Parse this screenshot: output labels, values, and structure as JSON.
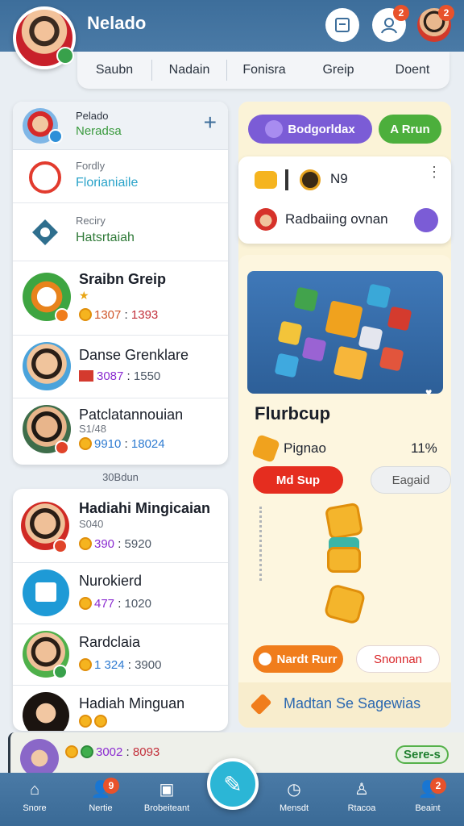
{
  "header": {
    "title": "Nelado",
    "notif_count_1": "2",
    "notif_count_2": "2"
  },
  "tabs": [
    "Saubn",
    "Nadain",
    "Fonisra",
    "Greip",
    "Doent"
  ],
  "left_panel": {
    "head": {
      "title": "Pelado",
      "subtitle": "Neradsa",
      "add_label": "+"
    },
    "rows": [
      {
        "small": "Fordly",
        "big": "Florianiaile"
      },
      {
        "small": "Reciry",
        "big": "Hatsrtaiah"
      },
      {
        "big": "Sraibn Greip",
        "stat1": "1307",
        "stat2": "1393"
      },
      {
        "big": "Danse Grenklare",
        "stat1": "3087",
        "stat2": "1550"
      },
      {
        "big": "Patclatannouian",
        "small": "S1/48",
        "stat1": "9910",
        "stat2": "18024"
      }
    ]
  },
  "section_label": "30Bdun",
  "left_panel2": {
    "rows": [
      {
        "big": "Hadiahi Mingicaian",
        "small": "S040",
        "stat1": "390",
        "stat2": "5920"
      },
      {
        "big": "Nurokierd",
        "stat1": "477",
        "stat2": "1020"
      },
      {
        "big": "Rardclaia",
        "stat1": "1 324",
        "stat2": "3900"
      },
      {
        "big": "Hadiah Minguan"
      }
    ]
  },
  "right_panel": {
    "pill_purple": "Bodgorldax",
    "pill_green": "A Rrun",
    "card1": {
      "code": "N9",
      "text": "Radbaiing ovnan"
    },
    "game_title": "Flurbcup",
    "progress_label": "Pignao",
    "progress_value": "11%",
    "btn_red": "Md Sup",
    "btn_grey": "Eagaid",
    "btn_orange": "Nardt Rurr",
    "btn_white": "Snonnan",
    "footer_text": "Madtan Se Sagewias"
  },
  "bottom_strip": {
    "stat1": "3002",
    "stat2": "8093",
    "badge": "Sere-s"
  },
  "bottom_nav": [
    {
      "label": "Snore"
    },
    {
      "label": "Nertie",
      "badge": "9"
    },
    {
      "label": "Brobeiteant"
    },
    {
      "label": "Mensdt"
    },
    {
      "label": "Rtacoa"
    },
    {
      "label": "Beaint",
      "badge": "2"
    }
  ],
  "colors": {
    "header": "#3d6e9b",
    "accent_green": "#38a14b",
    "accent_purple": "#7b5cd6",
    "accent_red": "#e52d1f",
    "accent_orange": "#f07d1c"
  }
}
